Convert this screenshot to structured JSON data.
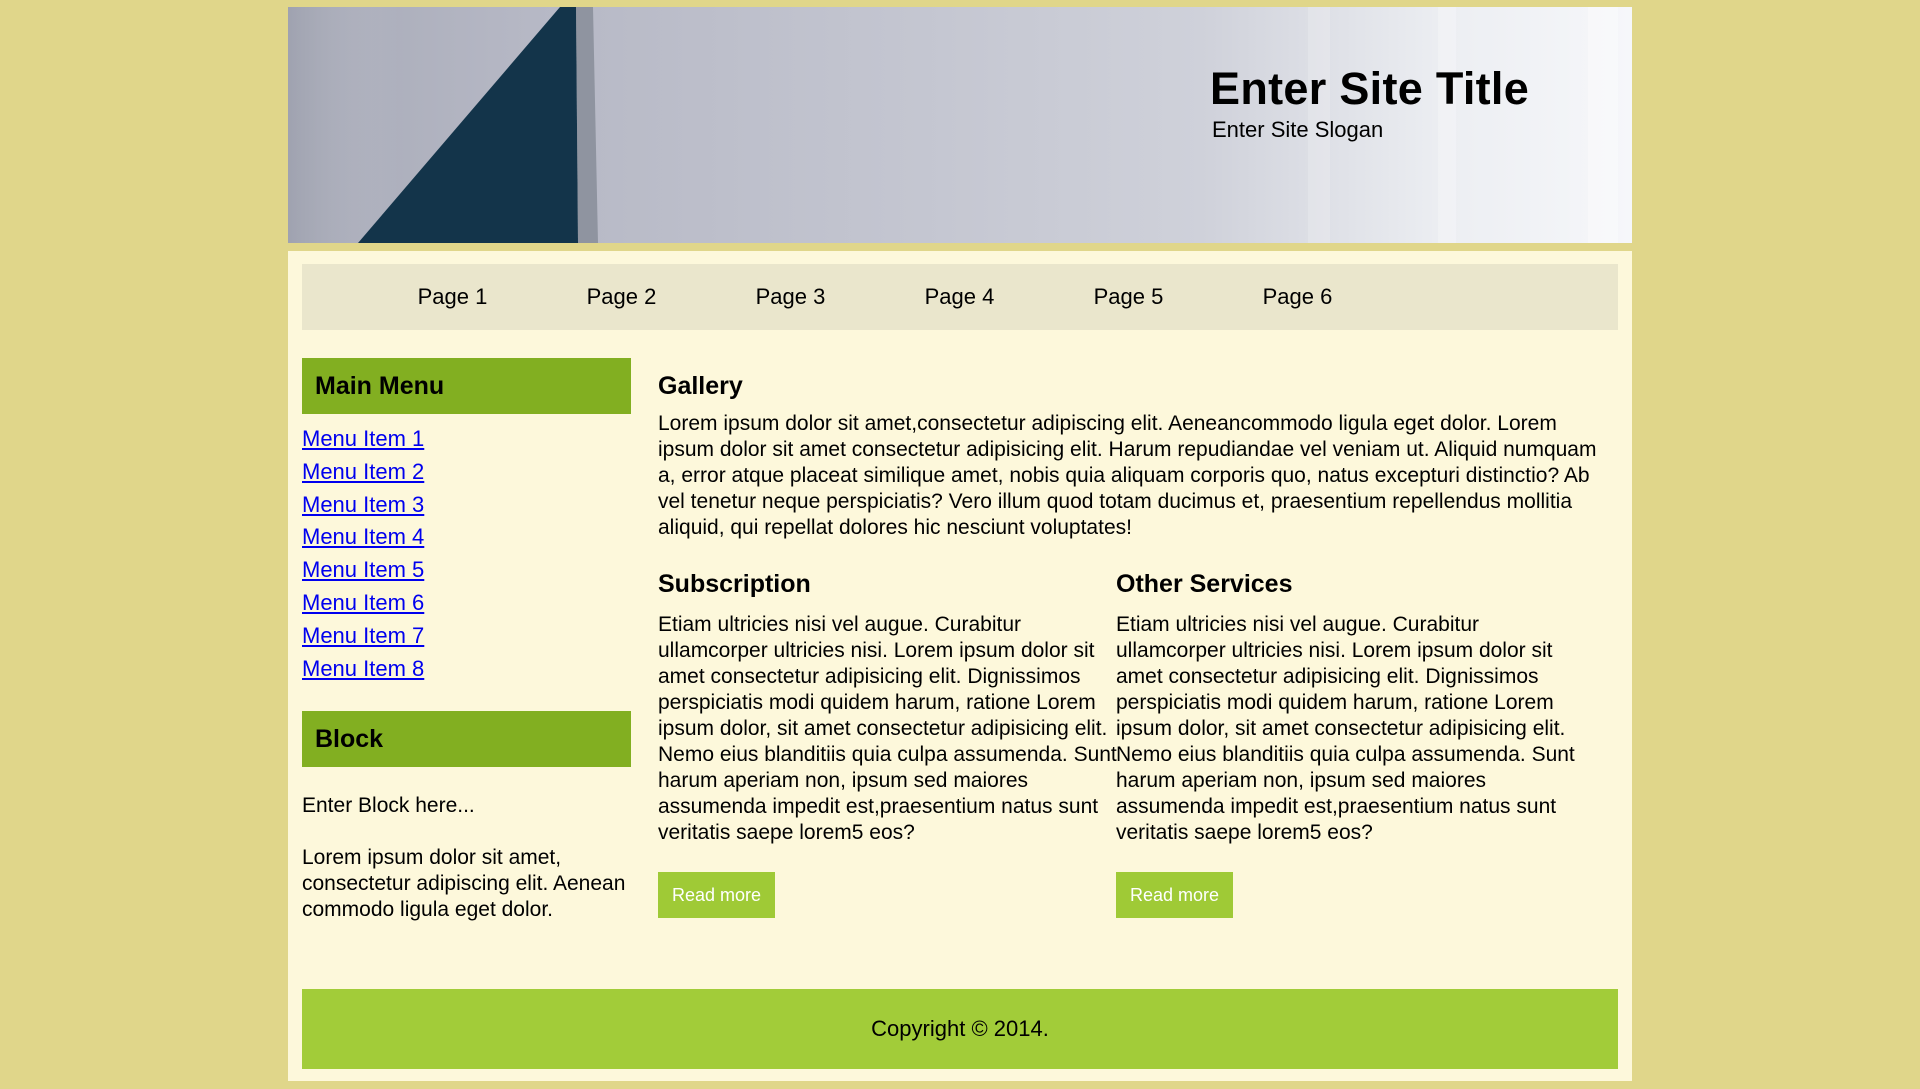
{
  "header": {
    "site_title": "Enter Site Title",
    "site_slogan": "Enter Site Slogan"
  },
  "nav": {
    "items": [
      "Page 1",
      "Page 2",
      "Page 3",
      "Page 4",
      "Page 5",
      "Page 6"
    ]
  },
  "sidebar": {
    "main_menu_title": "Main Menu",
    "menu_items": [
      "Menu Item 1",
      "Menu Item 2",
      "Menu Item 3",
      "Menu Item 4",
      "Menu Item 5",
      "Menu Item 6",
      "Menu Item 7",
      "Menu Item 8"
    ],
    "block_title": "Block",
    "block_intro": "Enter Block here...",
    "block_text": "Lorem ipsum dolor sit amet, consectetur adipiscing elit. Aenean commodo ligula eget dolor."
  },
  "main": {
    "gallery_title": "Gallery",
    "gallery_text": "Lorem ipsum dolor sit amet,consectetur adipiscing elit. Aeneancommodo ligula eget dolor. Lorem ipsum dolor sit amet consectetur adipisicing elit. Harum repudiandae vel veniam ut. Aliquid numquam a, error atque placeat similique amet, nobis quia aliquam corporis quo, natus excepturi distinctio? Ab vel tenetur neque perspiciatis? Vero illum quod totam ducimus et, praesentium repellendus mollitia aliquid, qui repellat dolores hic nesciunt voluptates!",
    "subscription_title": "Subscription",
    "subscription_text": "Etiam ultricies nisi vel augue. Curabitur ullamcorper ultricies nisi. Lorem ipsum dolor sit amet consectetur adipisicing elit. Dignissimos perspiciatis modi quidem harum, ratione Lorem ipsum dolor, sit amet consectetur adipisicing elit. Nemo eius blanditiis quia culpa assumenda. Sunt harum aperiam non, ipsum sed maiores assumenda impedit est,praesentium natus sunt veritatis saepe lorem5 eos?",
    "other_title": "Other Services",
    "other_text": "Etiam ultricies nisi vel augue. Curabitur ullamcorper ultricies nisi. Lorem ipsum dolor sit amet consectetur adipisicing elit. Dignissimos perspiciatis modi quidem harum, ratione Lorem ipsum dolor, sit amet consectetur adipisicing elit. Nemo eius blanditiis quia culpa assumenda. Sunt harum aperiam non, ipsum sed maiores assumenda impedit est,praesentium natus sunt veritatis saepe lorem5 eos?",
    "read_more_label": "Read more"
  },
  "footer": {
    "copyright": "Copyright © 2014."
  },
  "colors": {
    "page_bg": "#e0d68a",
    "panel_bg": "#fdf8db",
    "nav_bg": "#eae6cc",
    "block_header": "#82af21",
    "button": "#9fca36",
    "footer": "#a2cc39",
    "link": "#0000ee"
  }
}
